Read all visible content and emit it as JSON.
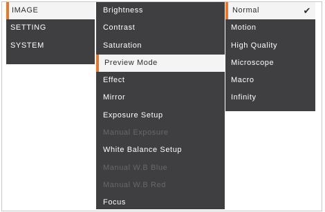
{
  "categories": {
    "items": [
      {
        "label": "IMAGE",
        "selected": true
      },
      {
        "label": "SETTING",
        "selected": false
      },
      {
        "label": "SYSTEM",
        "selected": false
      }
    ]
  },
  "image_menu": {
    "items": [
      {
        "label": "Brightness",
        "enabled": true
      },
      {
        "label": "Contrast",
        "enabled": true
      },
      {
        "label": "Saturation",
        "enabled": true
      },
      {
        "label": "Preview Mode",
        "enabled": true,
        "selected": true
      },
      {
        "label": "Effect",
        "enabled": true
      },
      {
        "label": "Mirror",
        "enabled": true
      },
      {
        "label": "Exposure Setup",
        "enabled": true
      },
      {
        "label": "Manual Exposure",
        "enabled": false
      },
      {
        "label": "White Balance Setup",
        "enabled": true
      },
      {
        "label": "Manual W.B Blue",
        "enabled": false
      },
      {
        "label": "Manual W.B Red",
        "enabled": false
      },
      {
        "label": "Focus",
        "enabled": true
      }
    ]
  },
  "preview_mode_options": {
    "items": [
      {
        "label": "Normal",
        "checked": true,
        "check_icon": "checkmark-icon",
        "check_glyph": "✔"
      },
      {
        "label": "Motion",
        "checked": false
      },
      {
        "label": "High Quality",
        "checked": false
      },
      {
        "label": "Microscope",
        "checked": false
      },
      {
        "label": "Macro",
        "checked": false
      },
      {
        "label": "Infinity",
        "checked": false
      }
    ]
  },
  "colors": {
    "menu_background": "#3f3f41",
    "selected_background": "#f4f4f4",
    "accent": "#e8762b",
    "text": "#ffffff",
    "disabled_text": "#686868"
  }
}
